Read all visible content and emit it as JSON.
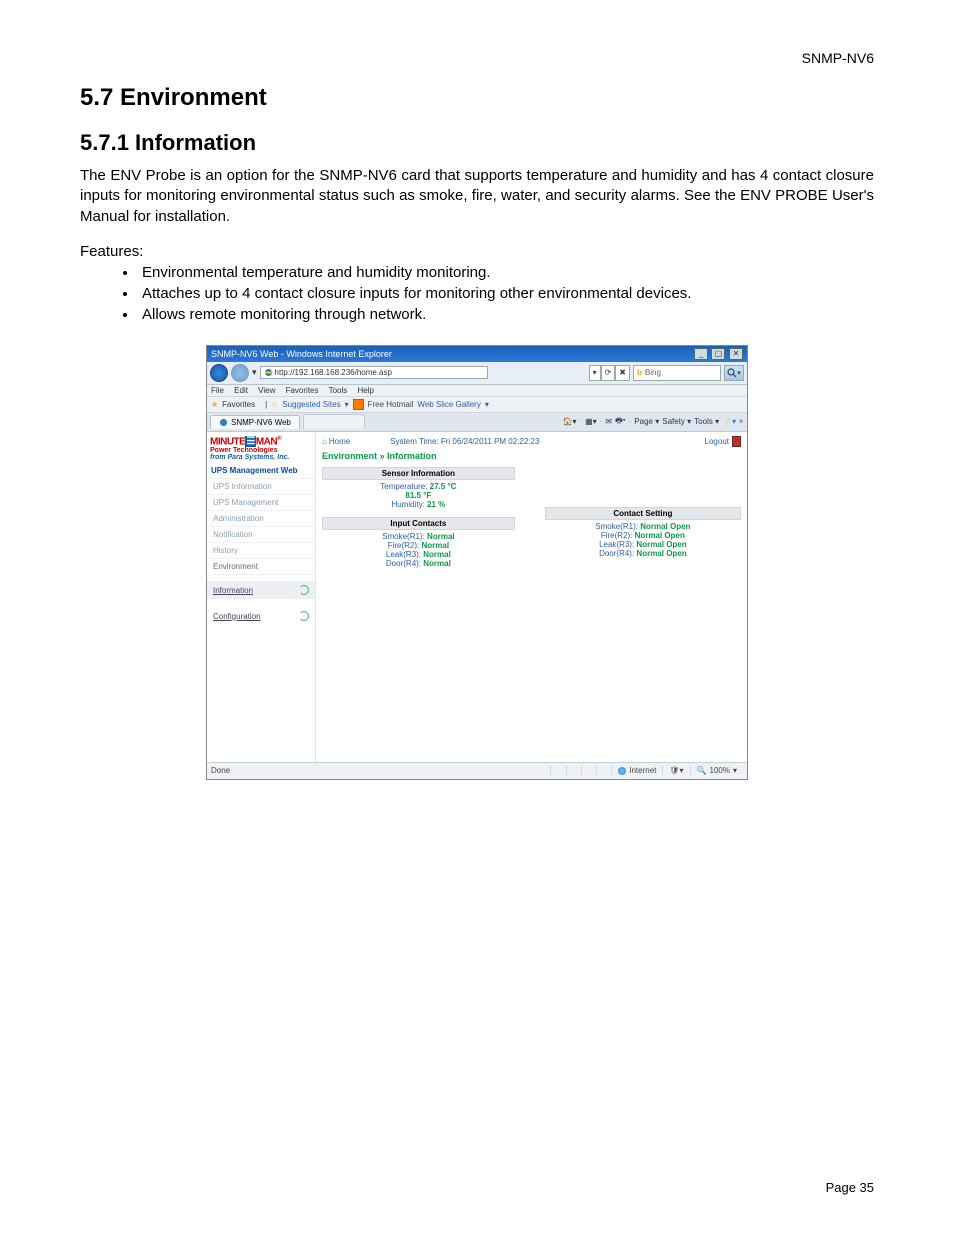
{
  "doc": {
    "header_label": "SNMP-NV6",
    "section_title": "5.7 Environment",
    "subsection_title": "5.7.1 Information",
    "paragraph": "The ENV Probe is an option for the SNMP-NV6 card that supports temperature and humidity and has 4 contact closure inputs for monitoring environmental status such as smoke, fire, water, and security alarms.  See the ENV PROBE User's Manual for installation.",
    "features_label": "Features:",
    "features": [
      "Environmental temperature and humidity monitoring.",
      "Attaches up to 4 contact closure inputs for monitoring other environmental devices.",
      "Allows remote monitoring through network."
    ],
    "page_num": "Page 35"
  },
  "ie": {
    "title": "SNMP-NV6 Web - Windows Internet Explorer",
    "url": "http://192.168.168.236/home.asp",
    "search_provider": "Bing",
    "search_icon_letter": "b",
    "menus": [
      "File",
      "Edit",
      "View",
      "Favorites",
      "Tools",
      "Help"
    ],
    "fav_label": "Favorites",
    "fav_links": {
      "suggested": "Suggested Sites",
      "hotmail": "Free Hotmail",
      "gallery": "Web Slice Gallery"
    },
    "tab_title": "SNMP-NV6 Web",
    "toolstrip": [
      "Page",
      "Safety",
      "Tools"
    ],
    "status_done": "Done",
    "status_zone": "Internet",
    "status_zoom": "100%"
  },
  "app": {
    "brand": {
      "line1a": "MINUTE",
      "line1b": "MAN",
      "line2": "Power Technologies",
      "line3": "from Para Systems, Inc."
    },
    "side_head": "UPS Management Web",
    "side_items": [
      "UPS Information",
      "UPS Management",
      "Administration",
      "Notification",
      "History",
      "Environment"
    ],
    "sub_items": [
      "Information",
      "Configuration"
    ],
    "home": "Home",
    "systime": "System Time: Fri 06/24/2011 PM 02:22:23",
    "logout": "Logout",
    "breadcrumb": "Environment » Information",
    "sensor_head": "Sensor Information",
    "sensor": {
      "temp_c_label": "Temperature:",
      "temp_c": "27.5 °C",
      "temp_f": "81.5 °F",
      "hum_label": "Humidity:",
      "hum": "21 %"
    },
    "input_head": "Input Contacts",
    "inputs": [
      {
        "label": "Smoke(R1):",
        "val": "Normal"
      },
      {
        "label": "Fire(R2):",
        "val": "Normal"
      },
      {
        "label": "Leak(R3):",
        "val": "Normal"
      },
      {
        "label": "Door(R4):",
        "val": "Normal"
      }
    ],
    "contact_head": "Contact Setting",
    "contacts": [
      {
        "label": "Smoke(R1):",
        "val": "Normal Open"
      },
      {
        "label": "Fire(R2):",
        "val": "Normal Open"
      },
      {
        "label": "Leak(R3):",
        "val": "Normal Open"
      },
      {
        "label": "Door(R4):",
        "val": "Normal Open"
      }
    ]
  }
}
